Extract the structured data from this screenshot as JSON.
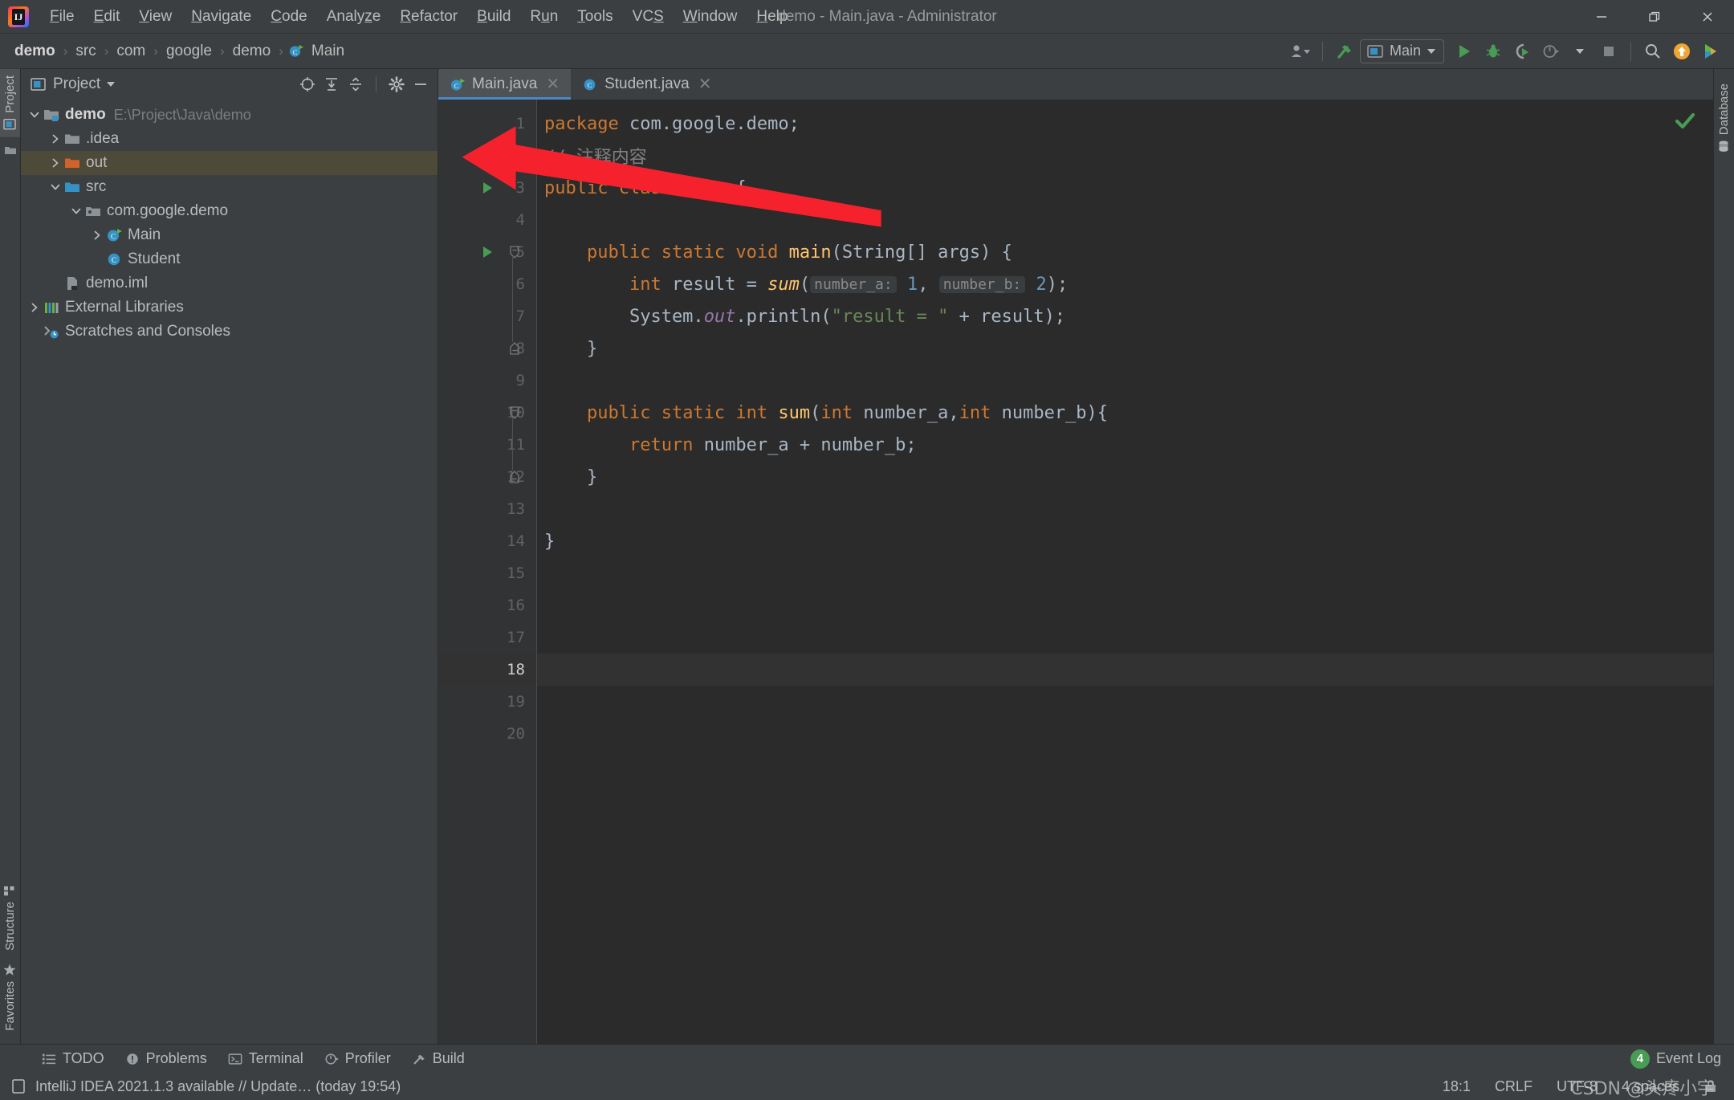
{
  "window": {
    "title": "demo - Main.java - Administrator",
    "minimize_icon": "minimize-icon",
    "maximize_icon": "restore-icon",
    "close_icon": "close-icon"
  },
  "menu": {
    "items": [
      {
        "label": "File",
        "mnemonic": "F"
      },
      {
        "label": "Edit",
        "mnemonic": "E"
      },
      {
        "label": "View",
        "mnemonic": "V"
      },
      {
        "label": "Navigate",
        "mnemonic": "N"
      },
      {
        "label": "Code",
        "mnemonic": "C"
      },
      {
        "label": "Analyze",
        "mnemonic": "z"
      },
      {
        "label": "Refactor",
        "mnemonic": "R"
      },
      {
        "label": "Build",
        "mnemonic": "B"
      },
      {
        "label": "Run",
        "mnemonic": "u"
      },
      {
        "label": "Tools",
        "mnemonic": "T"
      },
      {
        "label": "VCS",
        "mnemonic": "S"
      },
      {
        "label": "Window",
        "mnemonic": "W"
      },
      {
        "label": "Help",
        "mnemonic": "H"
      }
    ]
  },
  "breadcrumb": {
    "items": [
      {
        "label": "demo",
        "bold": true,
        "icon": ""
      },
      {
        "label": "src",
        "bold": false,
        "icon": ""
      },
      {
        "label": "com",
        "bold": false,
        "icon": ""
      },
      {
        "label": "google",
        "bold": false,
        "icon": ""
      },
      {
        "label": "demo",
        "bold": false,
        "icon": ""
      },
      {
        "label": "Main",
        "bold": false,
        "icon": "java-class-runnable-icon"
      }
    ],
    "separator": "›"
  },
  "toolbar": {
    "settings_account_icon": "account-icon",
    "build_icon": "build-hammer-icon",
    "run_config": {
      "label": "Main",
      "icon": "run-config-icon",
      "dropdown_icon": "chevron-down-icon"
    },
    "run_icon": "run-icon",
    "debug_icon": "debug-icon",
    "run_with_coverage_icon": "run-coverage-icon",
    "profile_icon": "profile-icon",
    "stop_icon": "stop-icon",
    "search_icon": "search-everywhere-icon",
    "update_icon": "update-available-icon",
    "ide_icon": "ide-features-icon"
  },
  "left_strip": {
    "top": [
      {
        "label": "Project",
        "icon": "project-icon",
        "active": true
      },
      {
        "label": "",
        "icon": "folder-icon",
        "active": false
      }
    ],
    "bottom": [
      {
        "label": "Structure",
        "icon": "structure-icon"
      },
      {
        "label": "Favorites",
        "icon": "star-icon"
      }
    ]
  },
  "right_strip": {
    "items": [
      {
        "label": "Database",
        "icon": "database-icon"
      }
    ]
  },
  "project_panel": {
    "title": "Project",
    "dropdown_icon": "chevron-down-icon",
    "header_icons": [
      "select-opened-file-icon",
      "expand-all-icon",
      "collapse-all-icon",
      "settings-gear-icon",
      "hide-icon"
    ],
    "tree": [
      {
        "label": "demo",
        "path": "E:\\Project\\Java\\demo",
        "icon": "module-icon",
        "indent": 0,
        "arrow": "down",
        "bold": true,
        "selected": false
      },
      {
        "label": ".idea",
        "path": "",
        "icon": "folder-grey-icon",
        "indent": 1,
        "arrow": "right",
        "bold": false,
        "selected": false
      },
      {
        "label": "out",
        "path": "",
        "icon": "folder-orange-icon",
        "indent": 1,
        "arrow": "right",
        "bold": false,
        "selected": true
      },
      {
        "label": "src",
        "path": "",
        "icon": "folder-source-icon",
        "indent": 1,
        "arrow": "down",
        "bold": false,
        "selected": false
      },
      {
        "label": "com.google.demo",
        "path": "",
        "icon": "package-icon",
        "indent": 2,
        "arrow": "down",
        "bold": false,
        "selected": false
      },
      {
        "label": "Main",
        "path": "",
        "icon": "java-class-runnable-icon",
        "indent": 3,
        "arrow": "right",
        "bold": false,
        "selected": false
      },
      {
        "label": "Student",
        "path": "",
        "icon": "java-class-icon",
        "indent": 3,
        "arrow": "none",
        "bold": false,
        "selected": false
      },
      {
        "label": "demo.iml",
        "path": "",
        "icon": "iml-file-icon",
        "indent": 1,
        "arrow": "none",
        "bold": false,
        "selected": false
      },
      {
        "label": "External Libraries",
        "path": "",
        "icon": "libraries-icon",
        "indent": 0,
        "arrow": "right",
        "bold": false,
        "selected": false
      },
      {
        "label": "Scratches and Consoles",
        "path": "",
        "icon": "scratches-icon",
        "indent": 0,
        "arrow": "none",
        "bold": false,
        "selected": false
      }
    ]
  },
  "editor": {
    "tabs": [
      {
        "label": "Main.java",
        "icon": "java-class-runnable-icon",
        "active": true,
        "close_icon": "close-icon"
      },
      {
        "label": "Student.java",
        "icon": "java-class-icon",
        "active": false,
        "close_icon": "close-icon"
      }
    ],
    "inspection_status_icon": "inspections-ok-checkmark",
    "current_line": 18,
    "total_lines": 20,
    "lines": [
      {
        "n": 1,
        "run_marker": false,
        "fold": "none",
        "tokens": [
          {
            "t": "package ",
            "c": "kw"
          },
          {
            "t": "com.google.demo;",
            "c": "pl"
          }
        ]
      },
      {
        "n": 2,
        "run_marker": false,
        "fold": "none",
        "tokens": [
          {
            "t": "// 注释内容",
            "c": "cmt"
          }
        ]
      },
      {
        "n": 3,
        "run_marker": true,
        "fold": "none",
        "tokens": [
          {
            "t": "public class ",
            "c": "kw"
          },
          {
            "t": "Main {",
            "c": "pl"
          }
        ]
      },
      {
        "n": 4,
        "run_marker": false,
        "fold": "none",
        "tokens": []
      },
      {
        "n": 5,
        "run_marker": true,
        "fold": "start",
        "tokens": [
          {
            "t": "    ",
            "c": "pl"
          },
          {
            "t": "public static void ",
            "c": "kw"
          },
          {
            "t": "main",
            "c": "fn"
          },
          {
            "t": "(String[] args) {",
            "c": "pl"
          }
        ]
      },
      {
        "n": 6,
        "run_marker": false,
        "fold": "none",
        "tokens": [
          {
            "t": "        ",
            "c": "pl"
          },
          {
            "t": "int ",
            "c": "kw"
          },
          {
            "t": "result = ",
            "c": "pl"
          },
          {
            "t": "sum",
            "c": "fni"
          },
          {
            "t": "(",
            "c": "pl"
          },
          {
            "t": "number_a:",
            "c": "hint"
          },
          {
            "t": " ",
            "c": "pl"
          },
          {
            "t": "1",
            "c": "num"
          },
          {
            "t": ", ",
            "c": "pl"
          },
          {
            "t": "number_b:",
            "c": "hint"
          },
          {
            "t": " ",
            "c": "pl"
          },
          {
            "t": "2",
            "c": "num"
          },
          {
            "t": ");",
            "c": "pl"
          }
        ]
      },
      {
        "n": 7,
        "run_marker": false,
        "fold": "none",
        "tokens": [
          {
            "t": "        System.",
            "c": "pl"
          },
          {
            "t": "out",
            "c": "fld"
          },
          {
            "t": ".println(",
            "c": "pl"
          },
          {
            "t": "\"result = \"",
            "c": "str"
          },
          {
            "t": " + result);",
            "c": "pl"
          }
        ]
      },
      {
        "n": 8,
        "run_marker": false,
        "fold": "end",
        "tokens": [
          {
            "t": "    }",
            "c": "pl"
          }
        ]
      },
      {
        "n": 9,
        "run_marker": false,
        "fold": "none",
        "tokens": []
      },
      {
        "n": 10,
        "run_marker": false,
        "fold": "start",
        "tokens": [
          {
            "t": "    ",
            "c": "pl"
          },
          {
            "t": "public static int ",
            "c": "kw"
          },
          {
            "t": "sum",
            "c": "fn"
          },
          {
            "t": "(",
            "c": "pl"
          },
          {
            "t": "int ",
            "c": "kw"
          },
          {
            "t": "number_a,",
            "c": "pl"
          },
          {
            "t": "int ",
            "c": "kw"
          },
          {
            "t": "number_b){",
            "c": "pl"
          }
        ]
      },
      {
        "n": 11,
        "run_marker": false,
        "fold": "none",
        "tokens": [
          {
            "t": "        ",
            "c": "pl"
          },
          {
            "t": "return ",
            "c": "kw"
          },
          {
            "t": "number_a + number_b;",
            "c": "pl"
          }
        ]
      },
      {
        "n": 12,
        "run_marker": false,
        "fold": "end",
        "tokens": [
          {
            "t": "    }",
            "c": "pl"
          }
        ]
      },
      {
        "n": 13,
        "run_marker": false,
        "fold": "none",
        "tokens": []
      },
      {
        "n": 14,
        "run_marker": false,
        "fold": "none",
        "tokens": [
          {
            "t": "}",
            "c": "pl"
          }
        ]
      },
      {
        "n": 15,
        "run_marker": false,
        "fold": "none",
        "tokens": []
      },
      {
        "n": 16,
        "run_marker": false,
        "fold": "none",
        "tokens": []
      },
      {
        "n": 17,
        "run_marker": false,
        "fold": "none",
        "tokens": []
      },
      {
        "n": 18,
        "run_marker": false,
        "fold": "none",
        "tokens": []
      },
      {
        "n": 19,
        "run_marker": false,
        "fold": "none",
        "tokens": []
      },
      {
        "n": 20,
        "run_marker": false,
        "fold": "none",
        "tokens": []
      }
    ]
  },
  "annotation": {
    "type": "red-arrow",
    "color": "#f5222d",
    "points_at": "// 注释内容"
  },
  "bottom_toolwindows": [
    {
      "label": "TODO",
      "icon": "todo-icon"
    },
    {
      "label": "Problems",
      "icon": "problems-icon"
    },
    {
      "label": "Terminal",
      "icon": "terminal-icon"
    },
    {
      "label": "Profiler",
      "icon": "profiler-icon"
    },
    {
      "label": "Build",
      "icon": "build-hammer-icon"
    }
  ],
  "event_log": {
    "label": "Event Log",
    "count": "4"
  },
  "statusbar": {
    "message_icon": "notification-icon",
    "message": "IntelliJ IDEA 2021.1.3 available // Update… (today 19:54)",
    "caret_position": "18:1",
    "line_separator": "CRLF",
    "encoding": "UTF-8",
    "indent": "4 spaces",
    "lock_icon": "read-only-lock-icon"
  },
  "watermark": "CSDN @头疼小宇",
  "colors": {
    "accent_blue": "#4a88c7",
    "selection": "#4e4a39",
    "keyword": "#cc7832",
    "string": "#6a8759",
    "number": "#6897bb",
    "comment": "#808080",
    "method": "#ffc66d",
    "field": "#9876aa",
    "bg_editor": "#2b2b2b",
    "bg_panel": "#3c3f41",
    "annotation_red": "#f5222d"
  }
}
